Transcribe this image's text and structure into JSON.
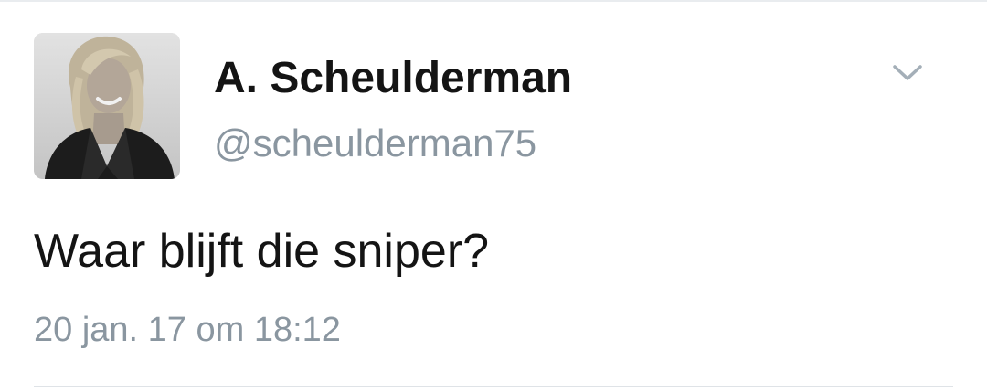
{
  "tweet": {
    "author": {
      "display_name": "A. Scheulderman",
      "handle": "@scheulderman75"
    },
    "text": "Waar blijft die sniper?",
    "timestamp": "20 jan. 17 om 18:12",
    "menu_icon": "chevron-down-icon"
  },
  "colors": {
    "text_primary": "#141414",
    "text_secondary": "#8a96a0",
    "divider": "#dfe3e7"
  }
}
